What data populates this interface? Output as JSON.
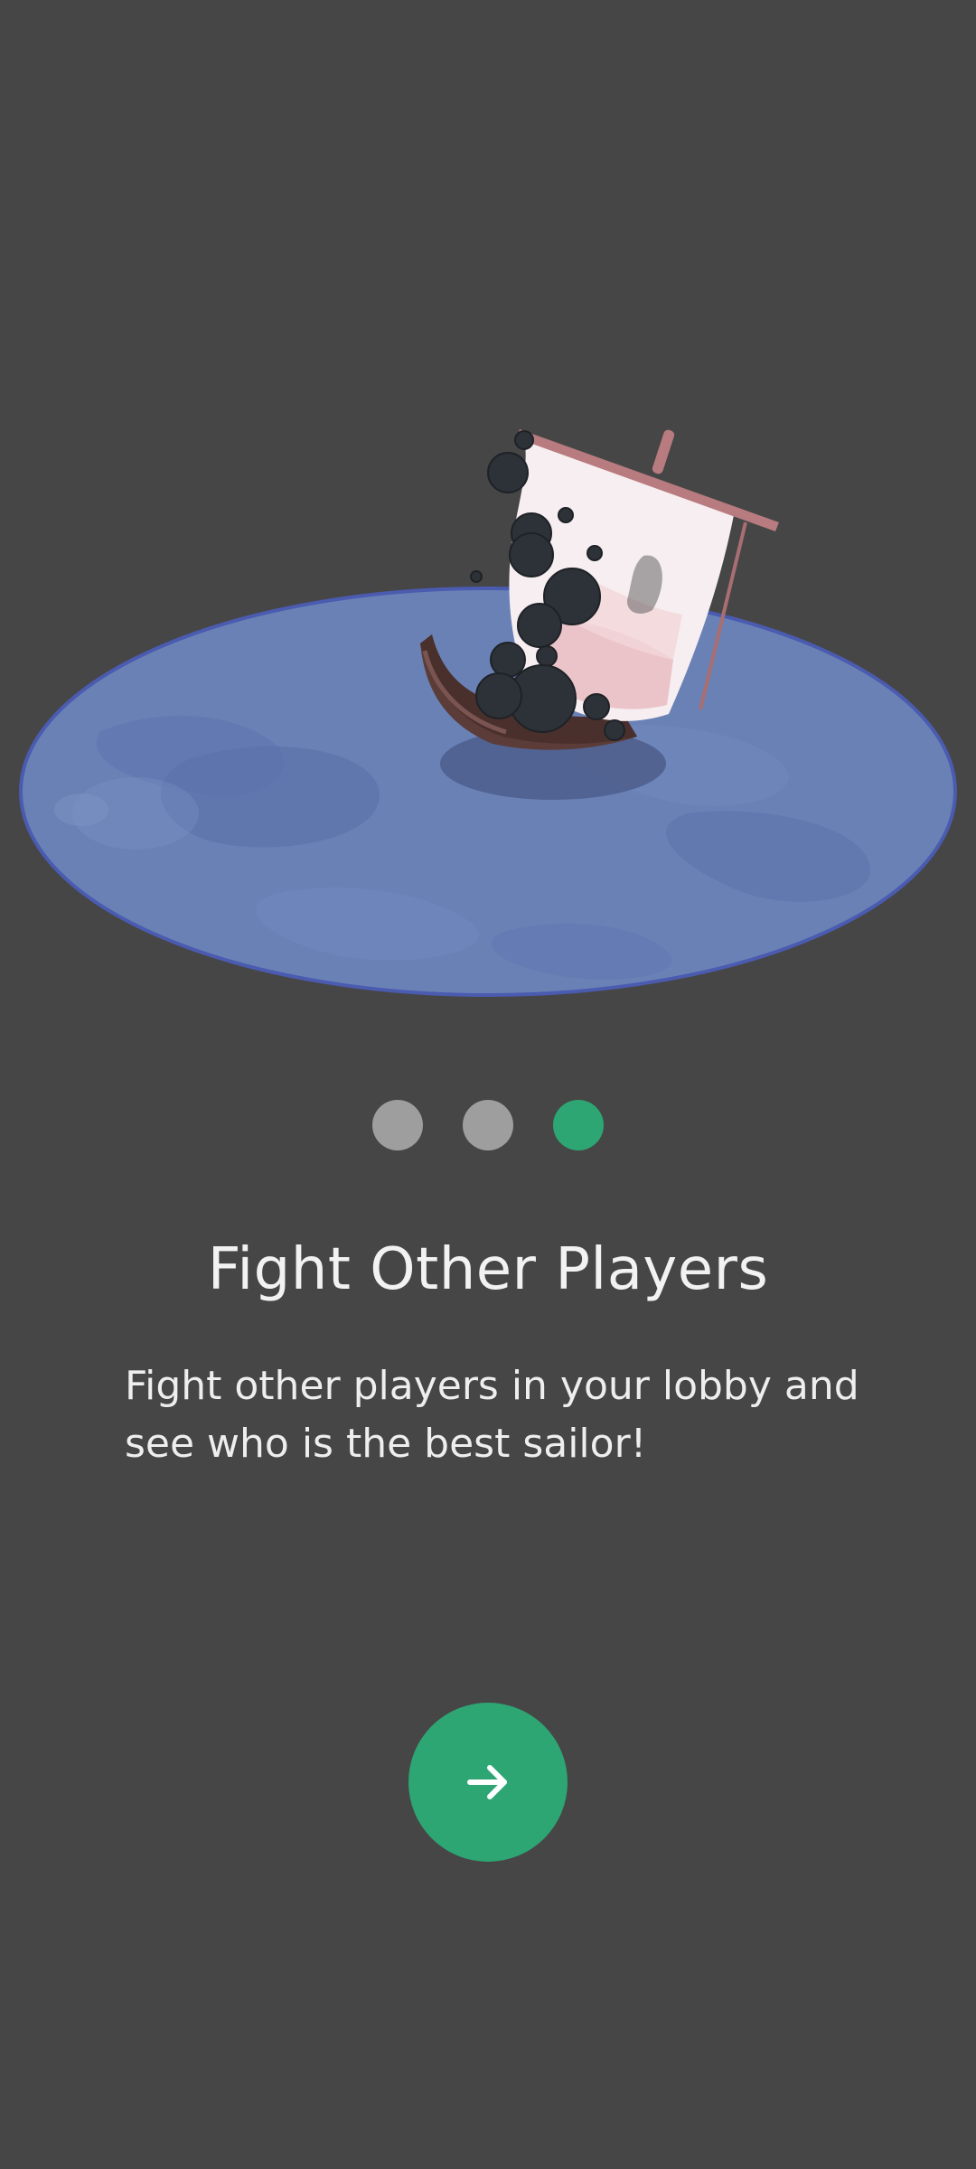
{
  "onboarding": {
    "title": "Fight Other Players",
    "description": "Fight other players in your lobby and see who is the best sailor!",
    "page_indicator": {
      "total": 3,
      "current": 3
    },
    "next_button": {
      "icon": "arrow-right-icon"
    }
  },
  "colors": {
    "background": "#464646",
    "accent": "#2ea673",
    "inactive_dot": "#9e9e9e",
    "water": "#6a81b6",
    "water_border": "#4a5bb0",
    "boat": "#5b3c38",
    "sail": "#f6eef0",
    "cannonball": "#2d3238"
  }
}
